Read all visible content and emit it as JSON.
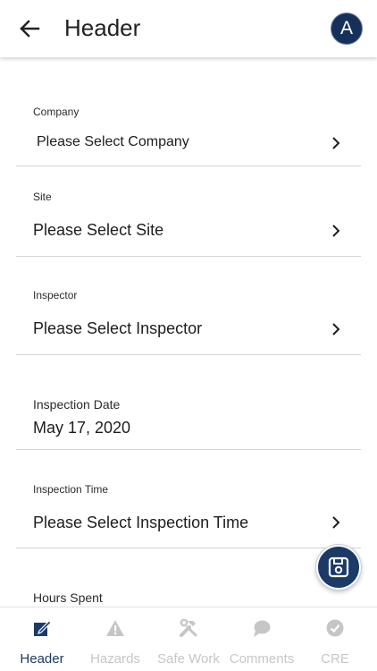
{
  "header": {
    "title": "Header",
    "avatar_letter": "A"
  },
  "form": {
    "company": {
      "label": "Company",
      "value": "Please Select Company"
    },
    "site": {
      "label": "Site",
      "value": "Please Select Site"
    },
    "inspector": {
      "label": "Inspector",
      "value": "Please Select Inspector"
    },
    "inspection_date": {
      "label": "Inspection Date",
      "value": "May 17, 2020"
    },
    "inspection_time": {
      "label": "Inspection Time",
      "value": "Please Select Inspection Time"
    },
    "hours_spent": {
      "label": "Hours Spent"
    }
  },
  "bottom_nav": {
    "items": [
      {
        "label": "Header",
        "icon": "edit-icon",
        "active": true
      },
      {
        "label": "Hazards",
        "icon": "warning-icon",
        "active": false
      },
      {
        "label": "Safe Work",
        "icon": "tools-icon",
        "active": false
      },
      {
        "label": "Comments",
        "icon": "comment-icon",
        "active": false
      },
      {
        "label": "CRE",
        "icon": "check-circle-icon",
        "active": false
      }
    ]
  },
  "colors": {
    "primary": "#1b3a66",
    "inactive": "#c6c6c6",
    "divider": "#d4d4d4"
  }
}
